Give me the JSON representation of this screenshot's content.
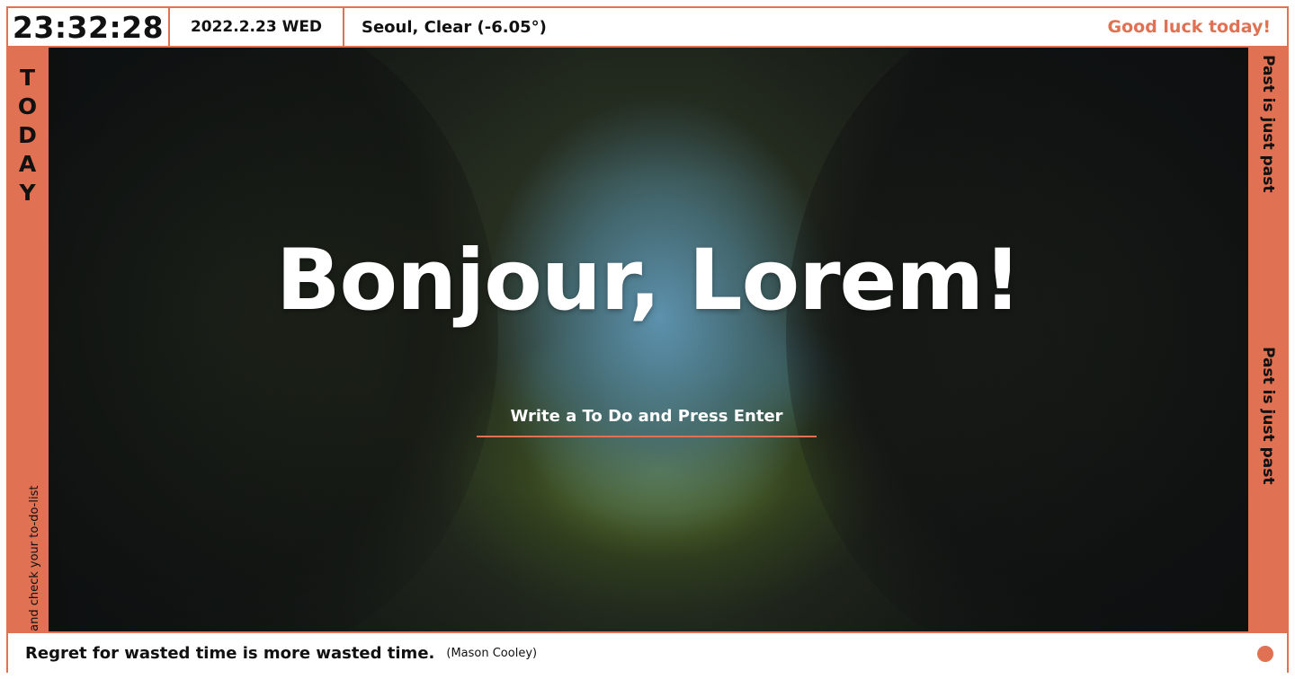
{
  "header": {
    "clock": "23:32:28",
    "date": "2022.2.23 WED",
    "weather": "Seoul, Clear (-6.05°)",
    "motto": "Good luck today!"
  },
  "left_sidebar": {
    "title_letters": [
      "T",
      "O",
      "D",
      "A",
      "Y"
    ],
    "todo_hint": "Click and check your to-do-list"
  },
  "right_sidebar": {
    "texts": [
      "Past is just past",
      "Past is just past"
    ]
  },
  "main": {
    "greeting": "Bonjour, Lorem!",
    "todo_placeholder": "Write a To Do and Press Enter"
  },
  "footer": {
    "quote": "Regret for wasted time is more wasted time.",
    "author": "(Mason Cooley)"
  },
  "colors": {
    "accent": "#e07152",
    "text": "#111111",
    "white": "#ffffff"
  },
  "icons": {
    "status_dot": "circle-dot-icon"
  }
}
